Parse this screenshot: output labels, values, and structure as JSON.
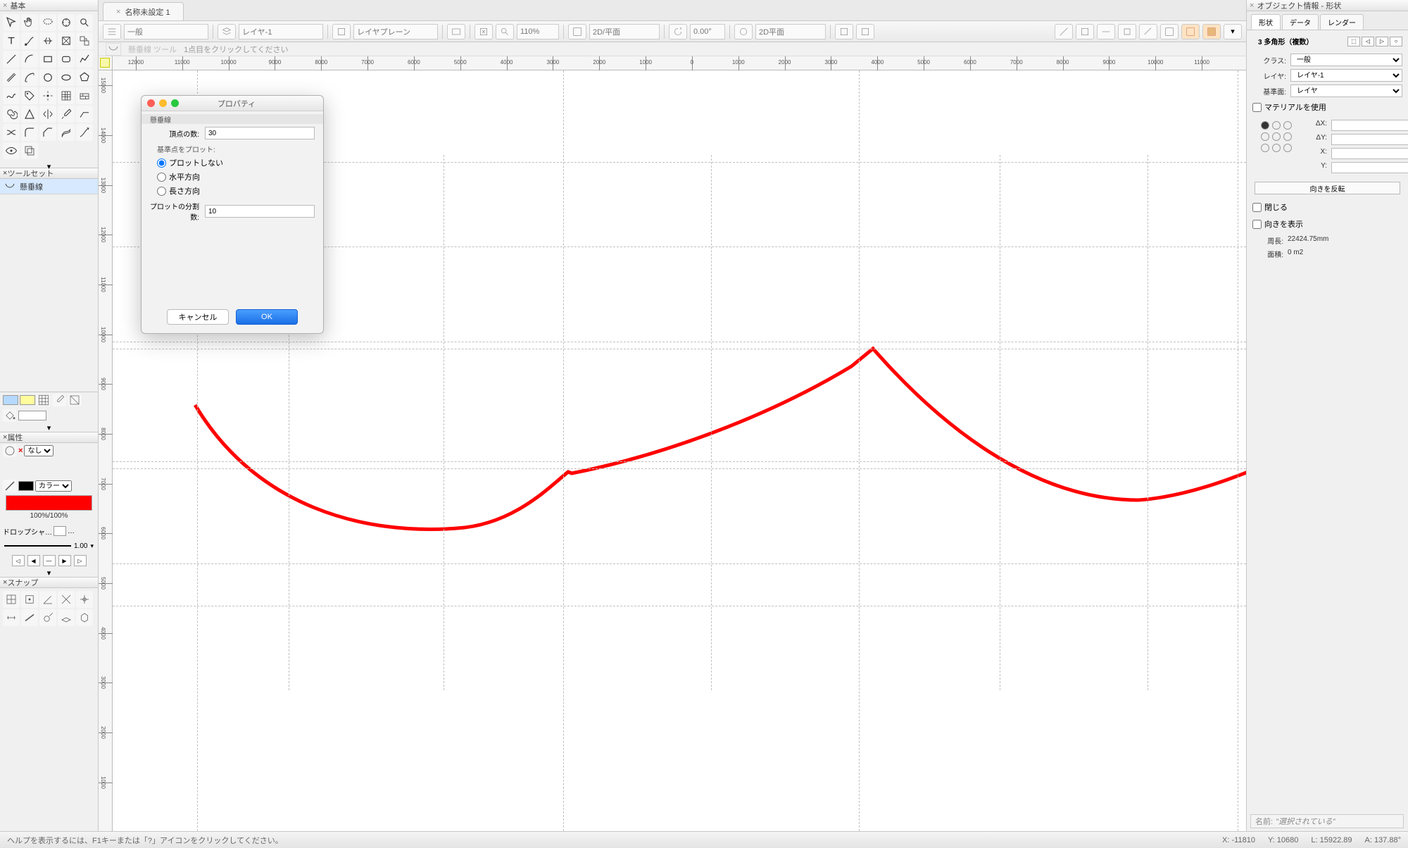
{
  "left_panel": {
    "basic_title": "基本",
    "toolset_title": "ツールセット",
    "toolset_item": "懸垂線",
    "attr_title": "属性",
    "attr_none": "なし",
    "attr_color": "カラー",
    "opacity": "100%/100%",
    "dropshadow": "ドロップシャ…",
    "line_w": "1.00",
    "snap_title": "スナップ"
  },
  "document": {
    "tab_name": "名称未設定 1"
  },
  "top_toolbar": {
    "class_sel": "一般",
    "layer_sel": "レイヤ-1",
    "story_sel": "レイヤプレーン",
    "zoom": "110%",
    "view_sel": "2D/平面",
    "angle": "0.00°",
    "render_sel": "2D平面"
  },
  "top_hint": {
    "tool": "懸垂線 ツール",
    "hint": "1点目をクリックしてください"
  },
  "ruler": {
    "h": [
      "12000",
      "11000",
      "10000",
      "9000",
      "8000",
      "7000",
      "6000",
      "5000",
      "4000",
      "3000",
      "2000",
      "1000",
      "0",
      "1000",
      "2000",
      "3000",
      "4000",
      "5000",
      "6000",
      "7000",
      "8000",
      "9000",
      "10000",
      "11000"
    ],
    "v": [
      "15000",
      "14000",
      "13000",
      "12000",
      "11000",
      "10000",
      "9000",
      "8000",
      "7000",
      "6000",
      "5000",
      "4000",
      "3000",
      "2000",
      "1000"
    ]
  },
  "dialog": {
    "title": "プロパティ",
    "section": "懸垂線",
    "field_points": "頂点の数:",
    "val_points": "30",
    "sub_label": "基準点をプロット:",
    "radio_none": "プロットしない",
    "radio_h": "水平方向",
    "radio_v": "長さ方向",
    "field_div": "プロットの分割数:",
    "val_div": "10",
    "cancel": "キャンセル",
    "ok": "OK"
  },
  "right_panel": {
    "header": "オブジェクト情報 - 形状",
    "tab_shape": "形状",
    "tab_data": "データ",
    "tab_render": "レンダー",
    "obj_title": "3 多角形（複数）",
    "class_label": "クラス:",
    "class_val": "一般",
    "layer_label": "レイヤ:",
    "layer_val": "レイヤ-1",
    "plane_label": "基準面:",
    "plane_val": "レイヤ",
    "material_chk": "マテリアルを使用",
    "dx": "ΔX:",
    "dy": "ΔY:",
    "x": "X:",
    "y": "Y:",
    "flip": "向きを反転",
    "chk_close": "閉じる",
    "chk_showdir": "向きを表示",
    "perim_label": "周長:",
    "perim_val": "22424.75mm",
    "area_label": "面積:",
    "area_val": "0 m2"
  },
  "statusbar": {
    "hint": "ヘルプを表示するには、F1キーまたは「?」アイコンをクリックしてください。",
    "x": "X: -11810",
    "y": "Y: 10680",
    "l": "L: 15922.89",
    "a": "A: 137.88°"
  },
  "sel_info": {
    "label": "名前:",
    "val": "\"選択されている\""
  }
}
